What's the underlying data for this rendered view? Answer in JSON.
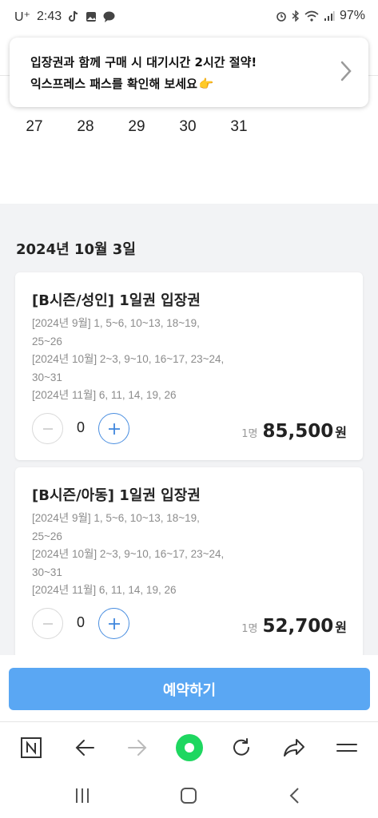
{
  "status_bar": {
    "carrier": "U⁺",
    "time": "2:43",
    "battery": "97%",
    "icons": [
      "tiktok-icon",
      "gallery-icon",
      "chat-icon",
      "alarm-icon",
      "bluetooth-icon",
      "wifi-icon",
      "signal-icon"
    ]
  },
  "banner": {
    "line1": "입장권과 함께 구매 시 대기시간 2시간 절약!",
    "line2": "익스프레스 패스를 확인해 보세요",
    "emoji": "👉"
  },
  "calendar": {
    "days": [
      "27",
      "28",
      "29",
      "30",
      "31"
    ]
  },
  "selected_date": "2024년 10월 3일",
  "tickets": [
    {
      "name": "[B시즌/성인] 1일권 입장권",
      "schedule": [
        "[2024년 9월] 1, 5~6, 10~13, 18~19,",
        "25~26",
        "[2024년 10월] 2~3, 9~10, 16~17, 23~24,",
        "30~31",
        "[2024년 11월] 6, 11, 14, 19, 26"
      ],
      "quantity": "0",
      "price_unit": "1명",
      "price": "85,500",
      "currency": "원"
    },
    {
      "name": "[B시즌/아동] 1일권 입장권",
      "schedule": [
        "[2024년 9월] 1, 5~6, 10~13, 18~19,",
        "25~26",
        "[2024년 10월] 2~3, 9~10, 16~17, 23~24,",
        "30~31",
        "[2024년 11월] 6, 11, 14, 19, 26"
      ],
      "quantity": "0",
      "price_unit": "1명",
      "price": "52,700",
      "currency": "원"
    }
  ],
  "reserve_button": "예약하기",
  "browser_toolbar": [
    "naver-home-icon",
    "back-icon",
    "forward-icon",
    "green-dot-icon",
    "refresh-icon",
    "share-icon",
    "menu-icon"
  ],
  "nav_bar": [
    "recent-apps-icon",
    "home-icon",
    "back-icon"
  ],
  "colors": {
    "accent": "#5aa7f3",
    "plus_blue": "#3f86dd",
    "green": "#1ed760",
    "background": "#f2f3f5"
  }
}
